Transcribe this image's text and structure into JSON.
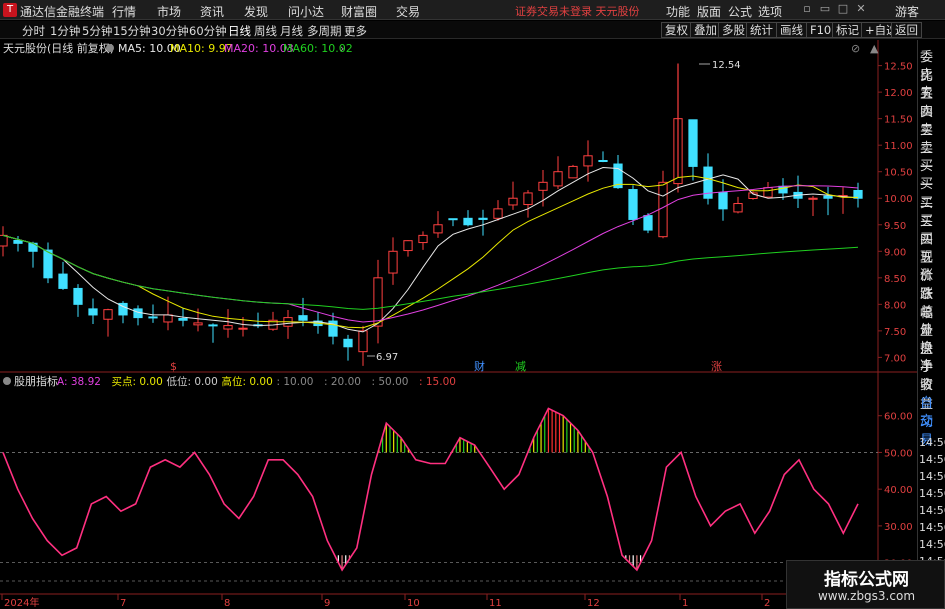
{
  "app": {
    "name": "通达信金融终端"
  },
  "menu": [
    "行情",
    "市场",
    "资讯",
    "发现",
    "问小达",
    "财富圈",
    "交易"
  ],
  "notice": {
    "text": "证券交易未登录",
    "stock": "天元股份"
  },
  "top_right": [
    "功能",
    "版面",
    "公式",
    "选项"
  ],
  "guest": "游客",
  "periods": [
    "分时",
    "1分钟",
    "5分钟",
    "15分钟",
    "30分钟",
    "60分钟",
    "日线",
    "周线",
    "月线",
    "多周期",
    "更多"
  ],
  "right_tools": [
    "复权",
    "叠加",
    "多股",
    "统计",
    "画线",
    "F10",
    "标记",
    "+自选",
    "返回"
  ],
  "main_chart": {
    "title": "天元股份(日线 前复权)",
    "ma": [
      {
        "label": "MA5: 10.00",
        "color": "#e8e8e8"
      },
      {
        "label": "MA10: 9.97",
        "color": "#e8e800"
      },
      {
        "label": "MA20: 10.03",
        "color": "#e040e0"
      },
      {
        "label": "MA60: 10.02",
        "color": "#20d020"
      }
    ],
    "high_label": "12.54",
    "low_label": "6.97",
    "y_ticks": [
      "12.50",
      "12.00",
      "11.50",
      "11.00",
      "10.50",
      "10.00",
      "9.50",
      "9.00",
      "8.50",
      "8.00",
      "7.50",
      "7.00"
    ],
    "events": [
      {
        "text": "$",
        "color": "#e04040"
      },
      {
        "text": "财",
        "color": "#4090ff"
      },
      {
        "text": "减",
        "color": "#20d020"
      },
      {
        "text": "涨",
        "color": "#e04040"
      }
    ]
  },
  "indicator": {
    "title": "股朋指标",
    "items": [
      {
        "label": "A:",
        "value": "38.92",
        "color": "#e040e0"
      },
      {
        "label": "买点:",
        "value": "0.00",
        "color": "#e8e800"
      },
      {
        "label": "低位:",
        "value": "0.00",
        "color": "#ccc"
      },
      {
        "label": "高位:",
        "value": "0.00",
        "color": "#e8e800"
      },
      {
        "label": ":",
        "value": "10.00",
        "color": "#888"
      },
      {
        "label": ":",
        "value": "20.00",
        "color": "#888"
      },
      {
        "label": ":",
        "value": "50.00",
        "color": "#888"
      },
      {
        "label": ":",
        "value": "15.00",
        "color": "#e04040"
      }
    ],
    "y_ticks": [
      "60.00",
      "50.00",
      "40.00",
      "30.00",
      "20.00"
    ]
  },
  "side_labels": [
    "委比",
    "卖五",
    "卖四",
    "卖三",
    "卖二",
    "卖一",
    "买一",
    "买二",
    "买三",
    "买四",
    "买五",
    "现价",
    "涨跌",
    "涨幅",
    "总量",
    "外盘",
    "换手",
    "净资",
    "收益",
    "自动",
    "交易"
  ],
  "times": [
    "14:56",
    "14:56",
    "14:56",
    "14:56",
    "14:56",
    "14:56",
    "14:56",
    "14:56",
    "14:56"
  ],
  "x_axis": [
    "2024年",
    "7",
    "8",
    "9",
    "10",
    "11",
    "12",
    "1",
    "2"
  ],
  "watermark": {
    "title": "指标公式网",
    "url": "www.zbgs3.com"
  },
  "chart_data": {
    "type": "candlestick",
    "title": "天元股份(日线 前复权)",
    "y_range": [
      6.8,
      12.7
    ],
    "ma_last": {
      "MA5": 10.0,
      "MA10": 9.97,
      "MA20": 10.03,
      "MA60": 10.02
    },
    "high": 12.54,
    "low": 6.97,
    "x_labels": [
      "2024年",
      "7",
      "8",
      "9",
      "10",
      "11",
      "12",
      "1",
      "2"
    ],
    "close": [
      9.3,
      9.15,
      9.0,
      8.5,
      8.3,
      8.0,
      7.8,
      7.9,
      7.8,
      7.75,
      7.75,
      7.8,
      7.7,
      7.65,
      7.6,
      7.6,
      7.55,
      7.6,
      7.7,
      7.75,
      7.7,
      7.6,
      7.4,
      7.2,
      7.5,
      8.5,
      9.0,
      9.2,
      9.3,
      9.5,
      9.6,
      9.5,
      9.6,
      9.8,
      10.0,
      10.1,
      10.3,
      10.5,
      10.6,
      10.8,
      10.7,
      10.2,
      9.6,
      9.4,
      10.3,
      11.5,
      10.6,
      10.0,
      9.8,
      9.9,
      10.1,
      10.2,
      10.1,
      10.0,
      10.0,
      10.0,
      10.05,
      10.0
    ],
    "indicator": {
      "name": "股朋指标",
      "A_last": 38.92,
      "y_range": [
        12,
        67
      ],
      "values": [
        50,
        40,
        32,
        26,
        22,
        24,
        36,
        38,
        34,
        36,
        46,
        48,
        46,
        50,
        44,
        36,
        32,
        38,
        48,
        48,
        44,
        38,
        26,
        18,
        24,
        44,
        58,
        54,
        48,
        47,
        47,
        54,
        52,
        46,
        40,
        44,
        54,
        62,
        60,
        56,
        50,
        38,
        22,
        18,
        26,
        46,
        50,
        38,
        30,
        34,
        36,
        28,
        34,
        44,
        48,
        40,
        36,
        28,
        36
      ],
      "buy_threshold": 20,
      "high_threshold": 50
    }
  }
}
